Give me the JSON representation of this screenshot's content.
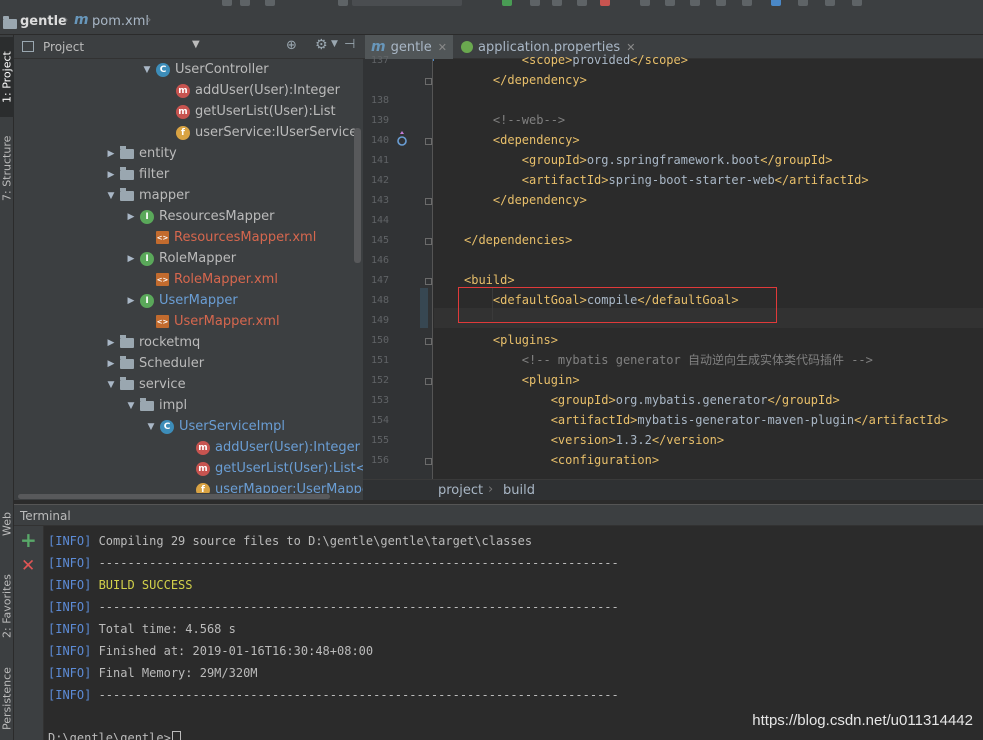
{
  "navbar": {
    "project": "gentle",
    "file": "pom.xml"
  },
  "side_tabs": {
    "project": "1: Project",
    "structure": "7: Structure",
    "web": "Web",
    "favorites": "2: Favorites",
    "persistence": "Persistence"
  },
  "project_panel": {
    "title": "Project",
    "tree": [
      {
        "label": "UserController",
        "type": "class",
        "arrow": "down"
      },
      {
        "label": "addUser(User):Integer",
        "type": "method",
        "arrow": ""
      },
      {
        "label": "getUserList(User):List",
        "type": "method",
        "arrow": ""
      },
      {
        "label": "userService:IUserService",
        "type": "field",
        "arrow": ""
      },
      {
        "label": "entity",
        "type": "package",
        "arrow": "right"
      },
      {
        "label": "filter",
        "type": "package",
        "arrow": "right"
      },
      {
        "label": "mapper",
        "type": "package",
        "arrow": "down"
      },
      {
        "label": "ResourcesMapper",
        "type": "interface",
        "arrow": "right"
      },
      {
        "label": "ResourcesMapper.xml",
        "type": "xml",
        "arrow": ""
      },
      {
        "label": "RoleMapper",
        "type": "interface",
        "arrow": "right"
      },
      {
        "label": "RoleMapper.xml",
        "type": "xml",
        "arrow": ""
      },
      {
        "label": "UserMapper",
        "type": "interface",
        "arrow": "right"
      },
      {
        "label": "UserMapper.xml",
        "type": "xml",
        "arrow": ""
      },
      {
        "label": "rocketmq",
        "type": "package",
        "arrow": "right"
      },
      {
        "label": "Scheduler",
        "type": "package",
        "arrow": "right"
      },
      {
        "label": "service",
        "type": "package",
        "arrow": "down"
      },
      {
        "label": "impl",
        "type": "package",
        "arrow": "down"
      },
      {
        "label": "UserServiceImpl",
        "type": "class",
        "arrow": "down"
      },
      {
        "label": "addUser(User):Integer",
        "type": "method",
        "arrow": ""
      },
      {
        "label": "getUserList(User):List<User>",
        "type": "method",
        "arrow": ""
      },
      {
        "label": "userMapper:UserMapper",
        "type": "field",
        "arrow": ""
      }
    ]
  },
  "editor": {
    "tabs": [
      {
        "label": "gentle",
        "active": true
      },
      {
        "label": "application.properties",
        "active": false
      }
    ],
    "lines": [
      {
        "n": "137",
        "text": "        <scope>provided</scope>"
      },
      {
        "n": "",
        "text": "    </dependency>"
      },
      {
        "n": "138",
        "text": ""
      },
      {
        "n": "139",
        "text": "    <!--web-->"
      },
      {
        "n": "140",
        "text": "    <dependency>"
      },
      {
        "n": "141",
        "text": "        <groupId>org.springframework.boot</groupId>"
      },
      {
        "n": "142",
        "text": "        <artifactId>spring-boot-starter-web</artifactId>"
      },
      {
        "n": "143",
        "text": "    </dependency>"
      },
      {
        "n": "144",
        "text": ""
      },
      {
        "n": "145",
        "text": "</dependencies>"
      },
      {
        "n": "146",
        "text": ""
      },
      {
        "n": "147",
        "text": "<build>"
      },
      {
        "n": "148",
        "text": "    <defaultGoal>compile</defaultGoal>"
      },
      {
        "n": "149",
        "text": ""
      },
      {
        "n": "150",
        "text": "    <plugins>"
      },
      {
        "n": "151",
        "text": "        <!-- mybatis generator 自动逆向生成实体类代码插件 -->"
      },
      {
        "n": "152",
        "text": "        <plugin>"
      },
      {
        "n": "153",
        "text": "            <groupId>org.mybatis.generator</groupId>"
      },
      {
        "n": "154",
        "text": "            <artifactId>mybatis-generator-maven-plugin</artifactId>"
      },
      {
        "n": "155",
        "text": "            <version>1.3.2</version>"
      },
      {
        "n": "156",
        "text": "            <configuration>"
      }
    ],
    "breadcrumbs": [
      "project",
      "build"
    ]
  },
  "terminal": {
    "title": "Terminal",
    "lines": [
      {
        "tag": "[INFO]",
        "text": " Compiling 29 source files to D:\\gentle\\gentle\\target\\classes",
        "success": false
      },
      {
        "tag": "[INFO]",
        "text": " ------------------------------------------------------------------------",
        "success": false
      },
      {
        "tag": "[INFO]",
        "text": " BUILD SUCCESS",
        "success": true
      },
      {
        "tag": "[INFO]",
        "text": " ------------------------------------------------------------------------",
        "success": false
      },
      {
        "tag": "[INFO]",
        "text": " Total time: 4.568 s",
        "success": false
      },
      {
        "tag": "[INFO]",
        "text": " Finished at: 2019-01-16T16:30:48+08:00",
        "success": false
      },
      {
        "tag": "[INFO]",
        "text": " Final Memory: 29M/320M",
        "success": false
      },
      {
        "tag": "[INFO]",
        "text": " ------------------------------------------------------------------------",
        "success": false
      }
    ],
    "prompt": "D:\\gentle\\gentle>"
  },
  "watermark": "https://blog.csdn.net/u011314442"
}
